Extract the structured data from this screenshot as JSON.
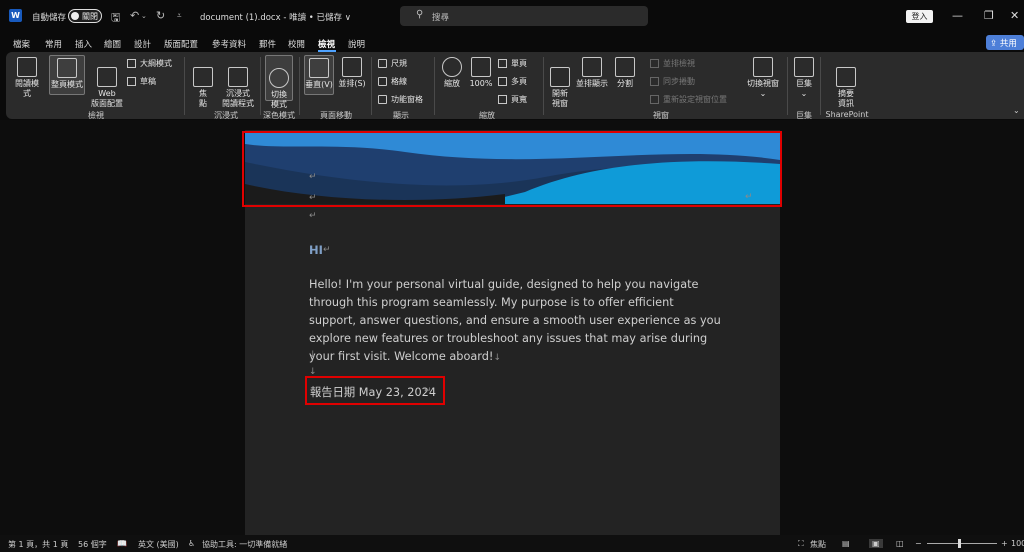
{
  "titlebar": {
    "autosave_label": "自動儲存",
    "autosave_state": "關閉",
    "doc_title": "document (1).docx  -  唯讀 • 已儲存 ∨",
    "search_placeholder": "搜尋",
    "signin_label": "登入"
  },
  "menu": {
    "items": [
      "檔案",
      "常用",
      "插入",
      "繪圖",
      "設計",
      "版面配置",
      "參考資料",
      "郵件",
      "校閱",
      "檢視",
      "說明"
    ],
    "active": "檢視",
    "share_label": "共用"
  },
  "ribbon": {
    "views": {
      "read_mode": "閱讀模式",
      "print_layout": "整頁模式",
      "web_layout": "Web\n版面配置",
      "outline": "大綱模式",
      "draft": "草稿",
      "group": "檢視"
    },
    "immersive": {
      "focus": "焦\n點",
      "immersive_reader": "沉浸式\n閱讀程式",
      "group": "沉浸式"
    },
    "dark_mode": {
      "switch_mode": "切換\n模式",
      "group": "深色模式"
    },
    "page_movement": {
      "vertical": "垂直(V)",
      "side_by_side": "並排(S)",
      "group": "頁面移動"
    },
    "show": {
      "ruler": "尺規",
      "gridlines": "格線",
      "nav_pane": "功能窗格",
      "group": "顯示"
    },
    "zoom": {
      "zoom": "縮放",
      "hundred": "100%",
      "one_page": "單頁",
      "multiple_pages": "多頁",
      "page_width": "頁寬",
      "group": "縮放"
    },
    "window": {
      "new_window": "開新\n視窗",
      "arrange_all": "並排顯示",
      "split": "分割",
      "view_side_by_side": "並排檢視",
      "sync_scroll": "同步捲動",
      "reset_position": "重新設定視窗位置",
      "switch_windows": "切換視窗",
      "group": "視窗"
    },
    "macros": {
      "macros": "巨集",
      "group": "巨集"
    },
    "sharepoint": {
      "properties": "摘要\n資訊",
      "group": "SharePoint"
    }
  },
  "document": {
    "greeting": "HI",
    "paragraph": "Hello! I'm your personal virtual guide, designed to help you navigate through this program seamlessly. My purpose is to offer efficient support, answer questions, and ensure a smooth user experience as you explore new features or troubleshoot any issues that may arise during your first visit. Welcome aboard!",
    "report_date": "報告日期 May 23, 2024",
    "para_mark": "↵",
    "line_mark": "↓"
  },
  "statusbar": {
    "page": "第 1 頁，共 1 頁",
    "words": "56 個字",
    "language": "英文 (美國)",
    "accessibility": "協助工具: 一切準備就緒",
    "focus": "焦點",
    "zoom_level": "100"
  },
  "colors": {
    "banner_dark": "#1f3f6f",
    "banner_light": "#2f8ad6",
    "highlight_box": "#e00000",
    "accent": "#4fa3ff"
  }
}
